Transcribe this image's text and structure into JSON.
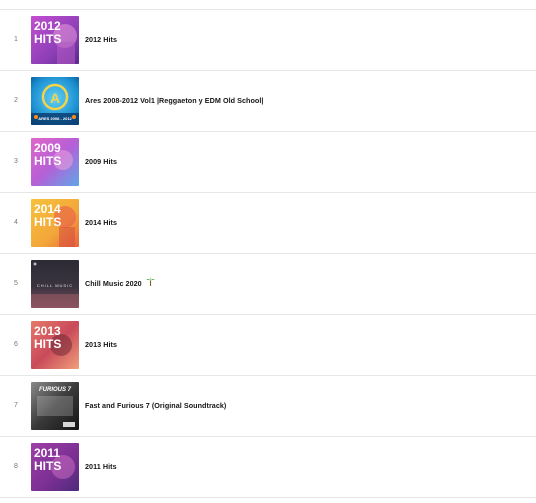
{
  "playlist": {
    "rows": [
      {
        "rank": "1",
        "title": "2012 Hits",
        "cover_text": "2012",
        "cover_sub": "HITS"
      },
      {
        "rank": "2",
        "title": "Ares 2008-2012 Vol1 |Reggaeton y EDM Old School|",
        "cover_text": "A",
        "cover_sub": "ARES 2008 - 2012"
      },
      {
        "rank": "3",
        "title": "2009 Hits",
        "cover_text": "2009",
        "cover_sub": "HITS"
      },
      {
        "rank": "4",
        "title": "2014 Hits",
        "cover_text": "2014",
        "cover_sub": "HITS"
      },
      {
        "rank": "5",
        "title": "Chill Music 2020",
        "title_icon": "palm-tree-icon",
        "cover_text": "CHILL MUSIC",
        "cover_sub": ""
      },
      {
        "rank": "6",
        "title": "2013 Hits",
        "cover_text": "2013",
        "cover_sub": "HITS"
      },
      {
        "rank": "7",
        "title": "Fast and Furious 7 (Original Soundtrack)",
        "cover_text": "FURIOUS 7",
        "cover_sub": ""
      },
      {
        "rank": "8",
        "title": "2011 Hits",
        "cover_text": "2011",
        "cover_sub": "HITS"
      }
    ]
  },
  "colors": {
    "divider": "#e6e6e6",
    "rank_text": "#777777",
    "title_text": "#161616"
  }
}
